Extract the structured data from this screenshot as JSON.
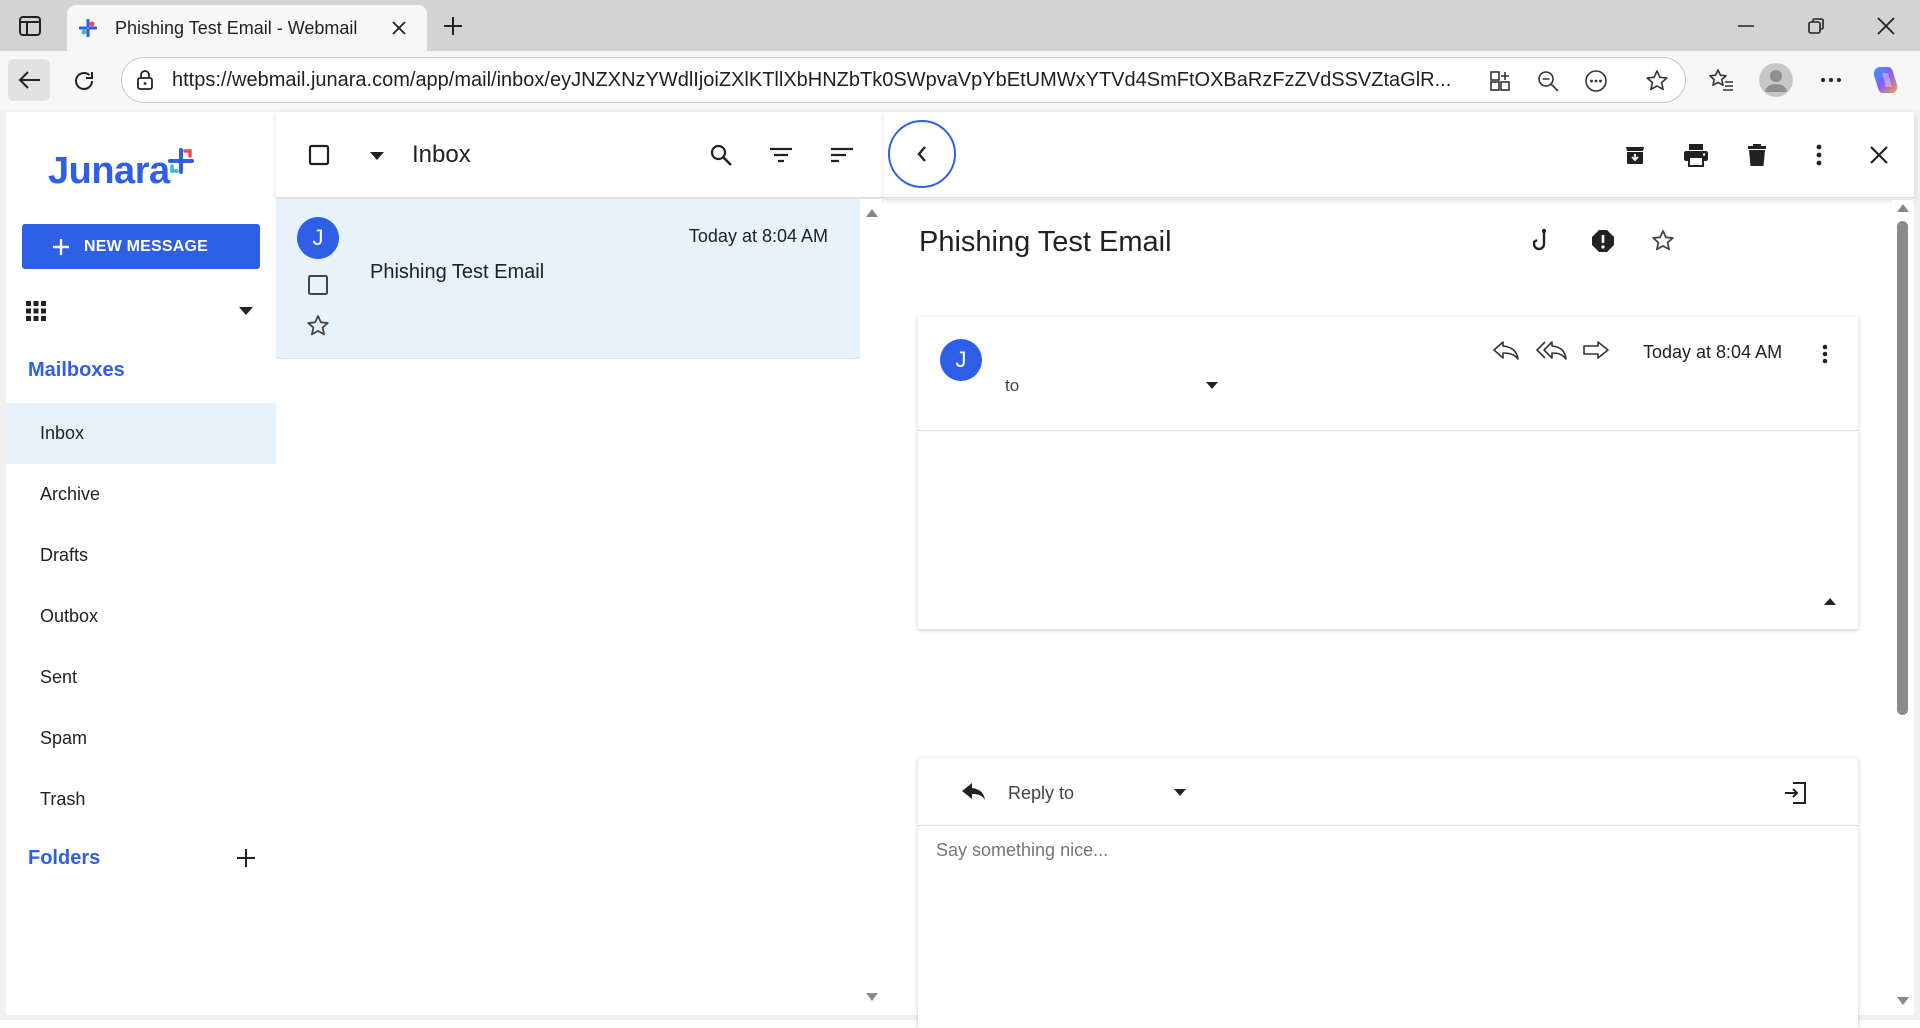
{
  "browser": {
    "tab_title": "Phishing Test Email - Webmail",
    "url": "https://webmail.junara.com/app/mail/inbox/eyJNZXNzYWdlIjoiZXlKTllXbHNZbTk0SWpvaVpYbEtUMWxYTVd4SmFtOXBaRzFzZVdSSVZtaGlR..."
  },
  "app": {
    "logo": "Junara",
    "new_message": "NEW MESSAGE",
    "mailboxes_title": "Mailboxes",
    "folders_title": "Folders",
    "mailboxes": [
      "Inbox",
      "Archive",
      "Drafts",
      "Outbox",
      "Sent",
      "Spam",
      "Trash"
    ],
    "active_mailbox": "Inbox"
  },
  "list": {
    "title": "Inbox",
    "messages": [
      {
        "avatar": "J",
        "subject": "Phishing Test Email",
        "time": "Today at 8:04 AM"
      }
    ]
  },
  "reader": {
    "subject": "Phishing Test Email",
    "avatar": "J",
    "to_label": "to",
    "time": "Today at 8:04 AM",
    "reply_label": "Reply to",
    "reply_placeholder": "Say something nice..."
  },
  "colors": {
    "accent": "#2e5fe6",
    "selected_bg": "#e8f2fb"
  },
  "icons": [
    "sidebar-toggle-icon",
    "favicon-icon",
    "close-icon",
    "plus-icon",
    "back-arrow-icon",
    "reload-icon",
    "lock-icon",
    "app-available-icon",
    "zoom-out-icon",
    "more-horizontal-icon",
    "favorite-star-icon",
    "favorites-icon",
    "profile-icon",
    "copilot-icon",
    "apps-grid-icon",
    "checkbox-icon",
    "dropdown-icon",
    "search-icon",
    "filter-icon",
    "sort-icon",
    "chevron-left-icon",
    "archive-icon",
    "print-icon",
    "trash-icon",
    "more-vertical-icon",
    "phishing-hook-icon",
    "report-icon",
    "star-icon",
    "reply-icon",
    "reply-all-icon",
    "forward-icon",
    "expand-up-icon",
    "pop-out-icon"
  ]
}
